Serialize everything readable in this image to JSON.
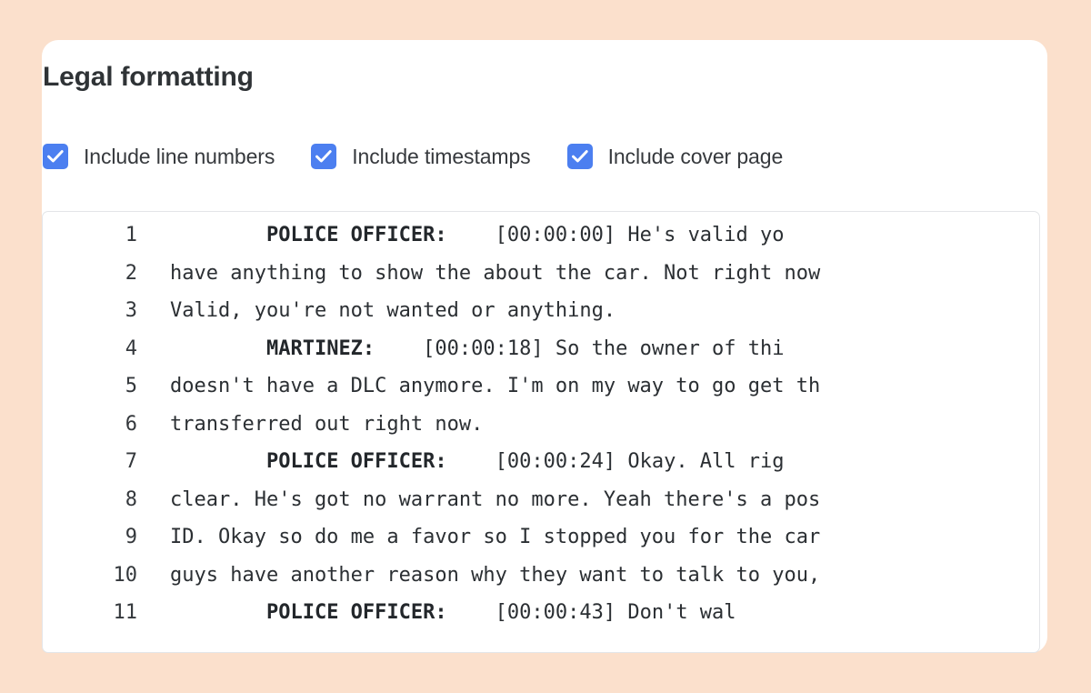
{
  "theme": {
    "page_background": "#FBE0CC",
    "card_background": "#FFFFFF",
    "checkbox_accent": "#4C7FF0",
    "text_color": "#2F3336",
    "box_border": "#E3E5E8"
  },
  "panel": {
    "title": "Legal formatting"
  },
  "options": [
    {
      "label": "Include line numbers",
      "checked": true,
      "name": "include-line-numbers"
    },
    {
      "label": "Include timestamps",
      "checked": true,
      "name": "include-timestamps"
    },
    {
      "label": "Include cover page",
      "checked": true,
      "name": "include-cover-page"
    }
  ],
  "transcript": {
    "lines": [
      {
        "number": "1",
        "speaker": "POLICE OFFICER:",
        "gap": "    ",
        "timestamp": "[00:00:00]",
        "text": " He's valid yo"
      },
      {
        "number": "2",
        "speaker": "",
        "gap": "",
        "timestamp": "",
        "text": "have anything to show the about the car. Not right now"
      },
      {
        "number": "3",
        "speaker": "",
        "gap": "",
        "timestamp": "",
        "text": "Valid, you're not wanted or anything."
      },
      {
        "number": "4",
        "speaker": "MARTINEZ:",
        "gap": "    ",
        "timestamp": "[00:00:18]",
        "text": " So the owner of thi"
      },
      {
        "number": "5",
        "speaker": "",
        "gap": "",
        "timestamp": "",
        "text": "doesn't have a DLC anymore. I'm on my way to go get th"
      },
      {
        "number": "6",
        "speaker": "",
        "gap": "",
        "timestamp": "",
        "text": "transferred out right now."
      },
      {
        "number": "7",
        "speaker": "POLICE OFFICER:",
        "gap": "    ",
        "timestamp": "[00:00:24]",
        "text": " Okay. All rig"
      },
      {
        "number": "8",
        "speaker": "",
        "gap": "",
        "timestamp": "",
        "text": "clear. He's got no warrant no more. Yeah there's a pos"
      },
      {
        "number": "9",
        "speaker": "",
        "gap": "",
        "timestamp": "",
        "text": "ID. Okay so do me a favor so I stopped you for the car"
      },
      {
        "number": "10",
        "speaker": "",
        "gap": "",
        "timestamp": "",
        "text": "guys have another reason why they want to talk to you,"
      },
      {
        "number": "11",
        "speaker": "POLICE OFFICER:",
        "gap": "    ",
        "timestamp": "[00:00:43]",
        "text": " Don't wal"
      }
    ],
    "speaker_indent": "        "
  },
  "icons": {
    "checkmark": "checkmark-icon"
  }
}
